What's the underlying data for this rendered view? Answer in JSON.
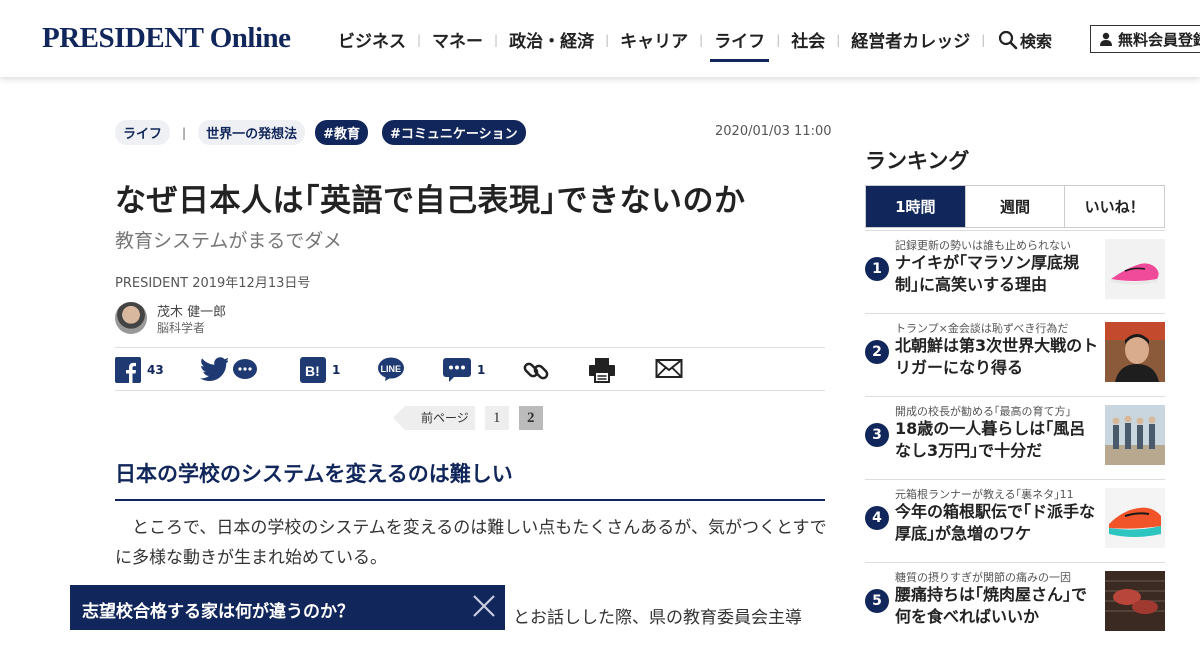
{
  "header": {
    "logo": "PRESIDENT Online",
    "nav": [
      "ビジネス",
      "マネー",
      "政治・経済",
      "キャリア",
      "ライフ",
      "社会",
      "経営者カレッジ"
    ],
    "active_nav": "ライフ",
    "search_label": "検索",
    "member_label": "無料会員登録",
    "brand_color": "#11265a"
  },
  "article": {
    "tags": {
      "category": "ライフ",
      "series": "世界一の発想法",
      "hashtag1": "#教育",
      "hashtag2": "#コミュニケーション"
    },
    "date": "2020/01/03 11:00",
    "title": "なぜ日本人は｢英語で自己表現｣できないのか",
    "subtitle": "教育システムがまるでダメ",
    "issue": "PRESIDENT 2019年12月13日号",
    "author_name": "茂木 健一郎",
    "author_role": "脳科学者",
    "share": {
      "facebook_count": "43",
      "hatena_count": "1",
      "comment_count": "1"
    },
    "pager": {
      "prev_label": "前ページ",
      "page1": "1",
      "page2": "2"
    },
    "section_heading": "日本の学校のシステムを変えるのは難しい",
    "paragraph1": "　ところで、日本の学校のシステムを変えるのは難しい点もたくさんあるが、気がつくとすでに多様な動きが生まれ始めている。",
    "paragraph2_fragment": "とお話しした際、県の教育委員会主導"
  },
  "banner": {
    "text": "志望校合格する家は何が違うのか？"
  },
  "ranking": {
    "title": "ランキング",
    "tabs": [
      "1時間",
      "週間",
      "いいね！"
    ],
    "items": [
      {
        "num": "1",
        "category": "記録更新の勢いは誰も止められない",
        "headline": "ナイキが｢マラソン厚底規制｣に高笑いする理由"
      },
      {
        "num": "2",
        "category": "トランプ×金会談は恥ずべき行為だ",
        "headline": "北朝鮮は第3次世界大戦のトリガーになり得る"
      },
      {
        "num": "3",
        "category": "開成の校長が勧める｢最高の育て方｣",
        "headline": "18歳の一人暮らしは｢風呂なし3万円｣で十分だ"
      },
      {
        "num": "4",
        "category": "元箱根ランナーが教える｢裏ネタ｣11",
        "headline": "今年の箱根駅伝で｢ド派手な厚底｣が急増のワケ"
      },
      {
        "num": "5",
        "category": "糖質の摂りすぎが関節の痛みの一因",
        "headline": "腰痛持ちは｢焼肉屋さん｣で何を食べればいいか"
      }
    ]
  }
}
